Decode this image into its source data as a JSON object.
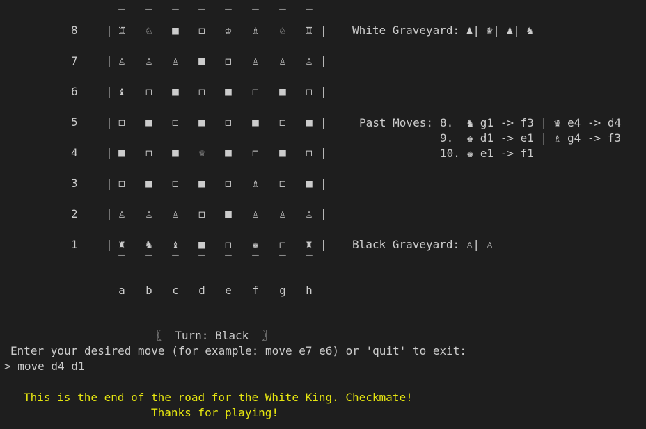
{
  "board": {
    "top_border": "‾",
    "bottom_border": "‾",
    "left_bar": "|",
    "right_bar": "|",
    "rows": [
      {
        "rank": "8",
        "cells": [
          "♖",
          "♘",
          "■",
          "◻",
          "♔",
          "♗",
          "♘",
          "♖"
        ]
      },
      {
        "rank": "7",
        "cells": [
          "♙",
          "♙",
          "♙",
          "■",
          "◻",
          "♙",
          "♙",
          "♙"
        ]
      },
      {
        "rank": "6",
        "cells": [
          "♝",
          "◻",
          "■",
          "◻",
          "■",
          "◻",
          "■",
          "◻"
        ]
      },
      {
        "rank": "5",
        "cells": [
          "◻",
          "■",
          "◻",
          "■",
          "◻",
          "■",
          "◻",
          "■"
        ]
      },
      {
        "rank": "4",
        "cells": [
          "■",
          "◻",
          "■",
          "♕",
          "■",
          "◻",
          "■",
          "◻"
        ]
      },
      {
        "rank": "3",
        "cells": [
          "◻",
          "■",
          "◻",
          "■",
          "◻",
          "♗",
          "◻",
          "■"
        ]
      },
      {
        "rank": "2",
        "cells": [
          "♙",
          "♙",
          "♙",
          "◻",
          "■",
          "♙",
          "♙",
          "♙"
        ]
      },
      {
        "rank": "1",
        "cells": [
          "♜",
          "♞",
          "♝",
          "■",
          "◻",
          "♚",
          "◻",
          "♜"
        ]
      }
    ],
    "files": [
      "a",
      "b",
      "c",
      "d",
      "e",
      "f",
      "g",
      "h"
    ]
  },
  "white_graveyard": {
    "label": "White Graveyard:",
    "pieces": "♟| ♛| ♟| ♞"
  },
  "past_moves": {
    "label": "Past Moves:",
    "lines": [
      "8.  ♞ g1 -> f3 | ♛ e4 -> d4",
      "9.  ♚ d1 -> e1 | ♗ g4 -> f3",
      "10. ♚ e1 -> f1"
    ]
  },
  "black_graveyard": {
    "label": "Black Graveyard:",
    "pieces": "♙| ♙"
  },
  "turn": "〖  Turn: Black  〗",
  "prompt": "Enter your desired move (for example: move e7 e6) or 'quit' to exit:",
  "input_line": "> move d4 d1",
  "messages": {
    "checkmate": "This is the end of the road for the White King. Checkmate!",
    "thanks": "Thanks for playing!"
  }
}
